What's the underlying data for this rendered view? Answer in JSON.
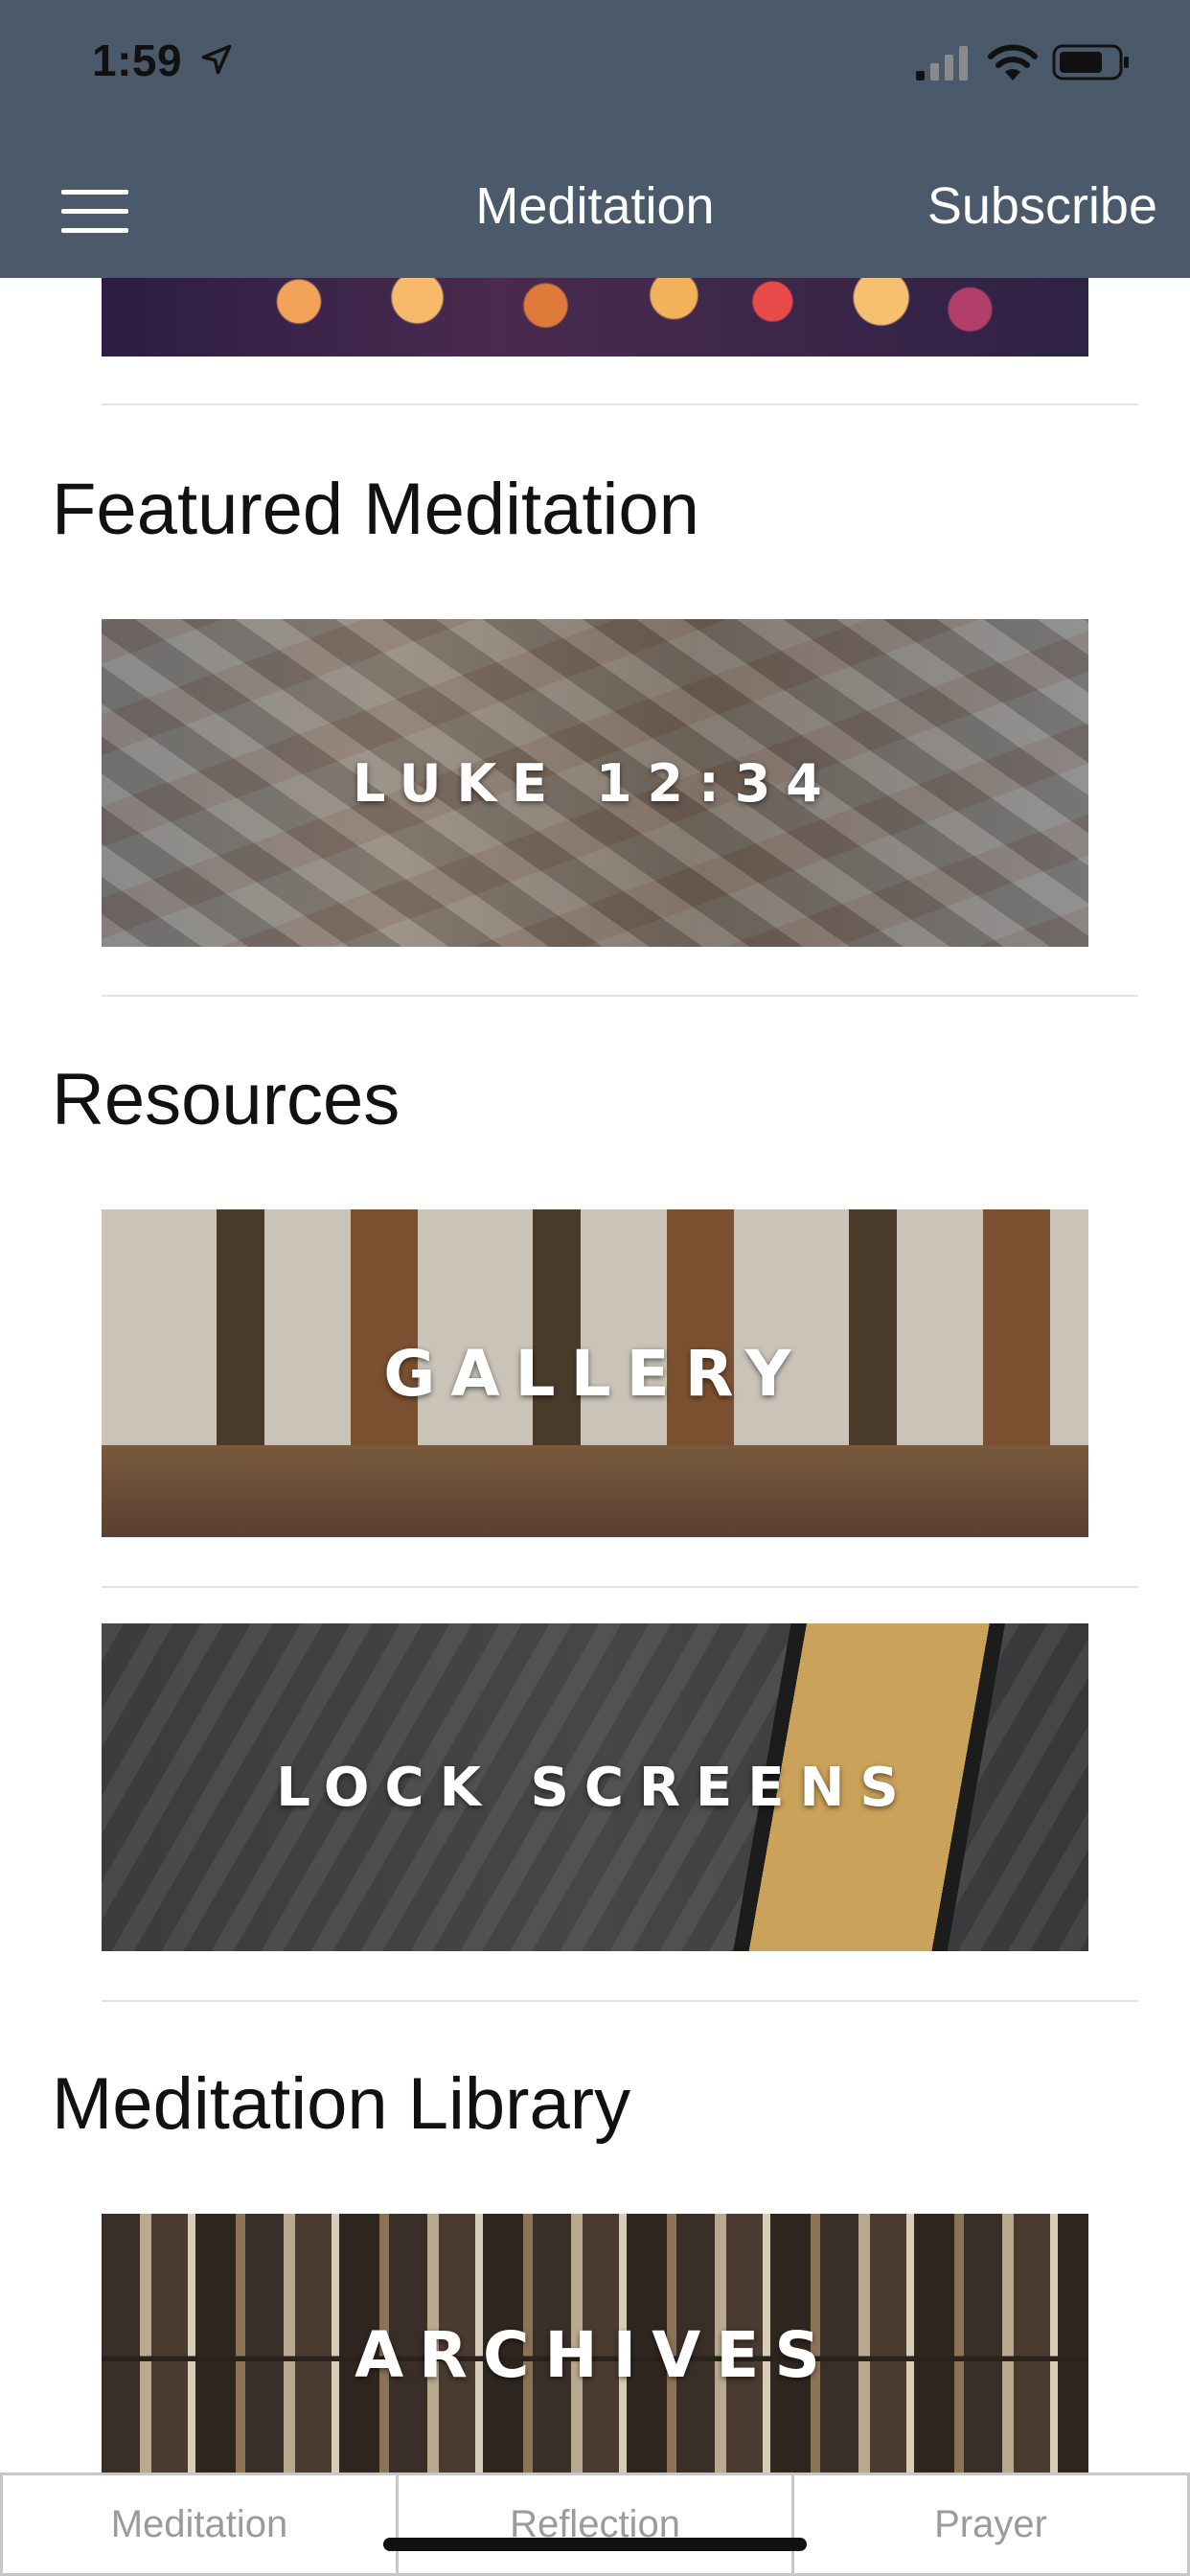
{
  "status_bar": {
    "time": "1:59",
    "icons": [
      "location-arrow-icon",
      "cellular-signal-icon",
      "wifi-icon",
      "battery-icon"
    ]
  },
  "nav": {
    "title": "Meditation",
    "subscribe_label": "Subscribe",
    "menu_icon": "hamburger-menu-icon"
  },
  "sections": {
    "featured": {
      "title": "Featured Meditation",
      "card_label": "LUKE 12:34"
    },
    "resources": {
      "title": "Resources",
      "cards": [
        {
          "label": "GALLERY"
        },
        {
          "label": "LOCK SCREENS"
        }
      ]
    },
    "library": {
      "title": "Meditation Library",
      "card_label": "ARCHIVES"
    }
  },
  "tabs": [
    {
      "label": "Meditation"
    },
    {
      "label": "Reflection"
    },
    {
      "label": "Prayer"
    }
  ],
  "colors": {
    "header_bg": "#4b5a6b",
    "header_text": "#ffffff",
    "tab_text": "#9b9b9b"
  }
}
